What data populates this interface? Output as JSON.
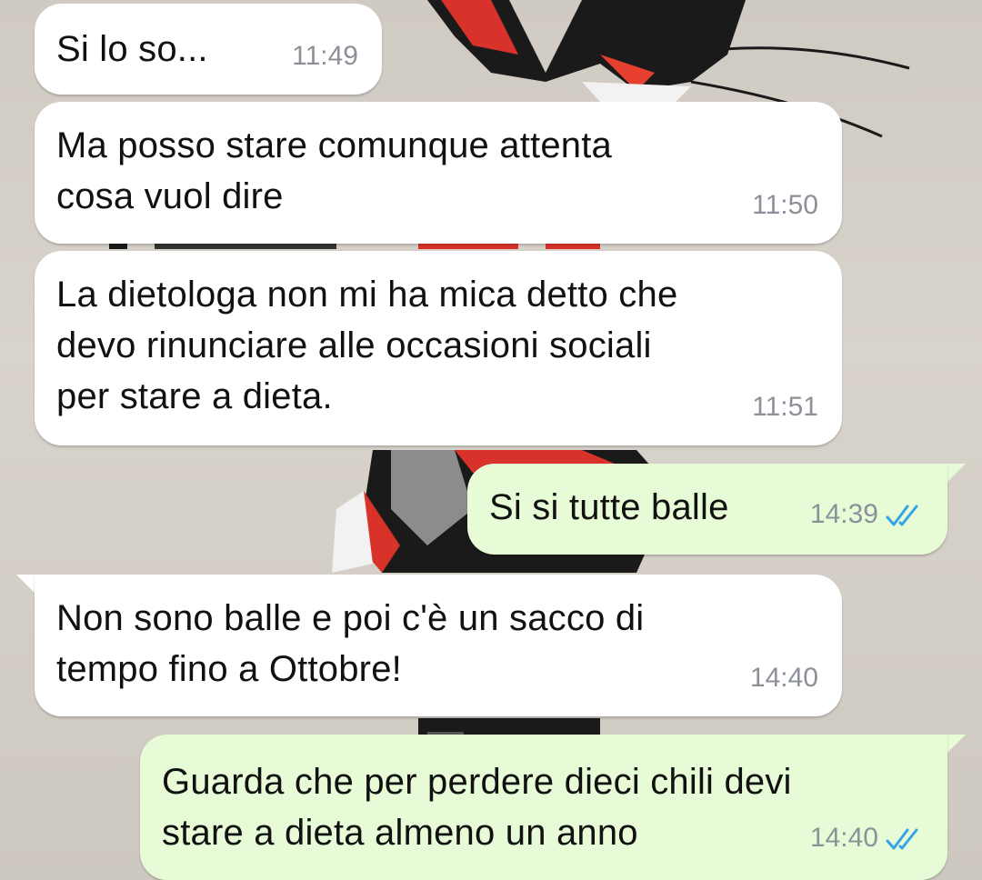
{
  "chat": {
    "messages": [
      {
        "direction": "incoming",
        "text": "Si lo so...",
        "time": "11:49"
      },
      {
        "direction": "incoming",
        "text": "Ma posso stare comunque attenta\ncosa vuol dire",
        "time": "11:50"
      },
      {
        "direction": "incoming",
        "text": "La dietologa non mi ha mica detto che\ndevo rinunciare alle occasioni sociali\nper stare a dieta.",
        "time": "11:51"
      },
      {
        "direction": "outgoing",
        "text": "Si si tutte balle",
        "time": "14:39",
        "status_icon": "double-check-read-icon"
      },
      {
        "direction": "incoming",
        "text": "Non sono balle e poi c'è un sacco di\ntempo fino a Ottobre!",
        "time": "14:40"
      },
      {
        "direction": "outgoing",
        "text": "Guarda che per perdere dieci chili devi\nstare a dieta almeno un anno",
        "time": "14:40",
        "status_icon": "double-check-read-icon"
      }
    ]
  },
  "colors": {
    "incoming_bubble": "#ffffff",
    "outgoing_bubble": "#e7fcd6",
    "timestamp": "#8c9199",
    "read_tick": "#34a3e8",
    "wallpaper": "#d4cfc7"
  }
}
